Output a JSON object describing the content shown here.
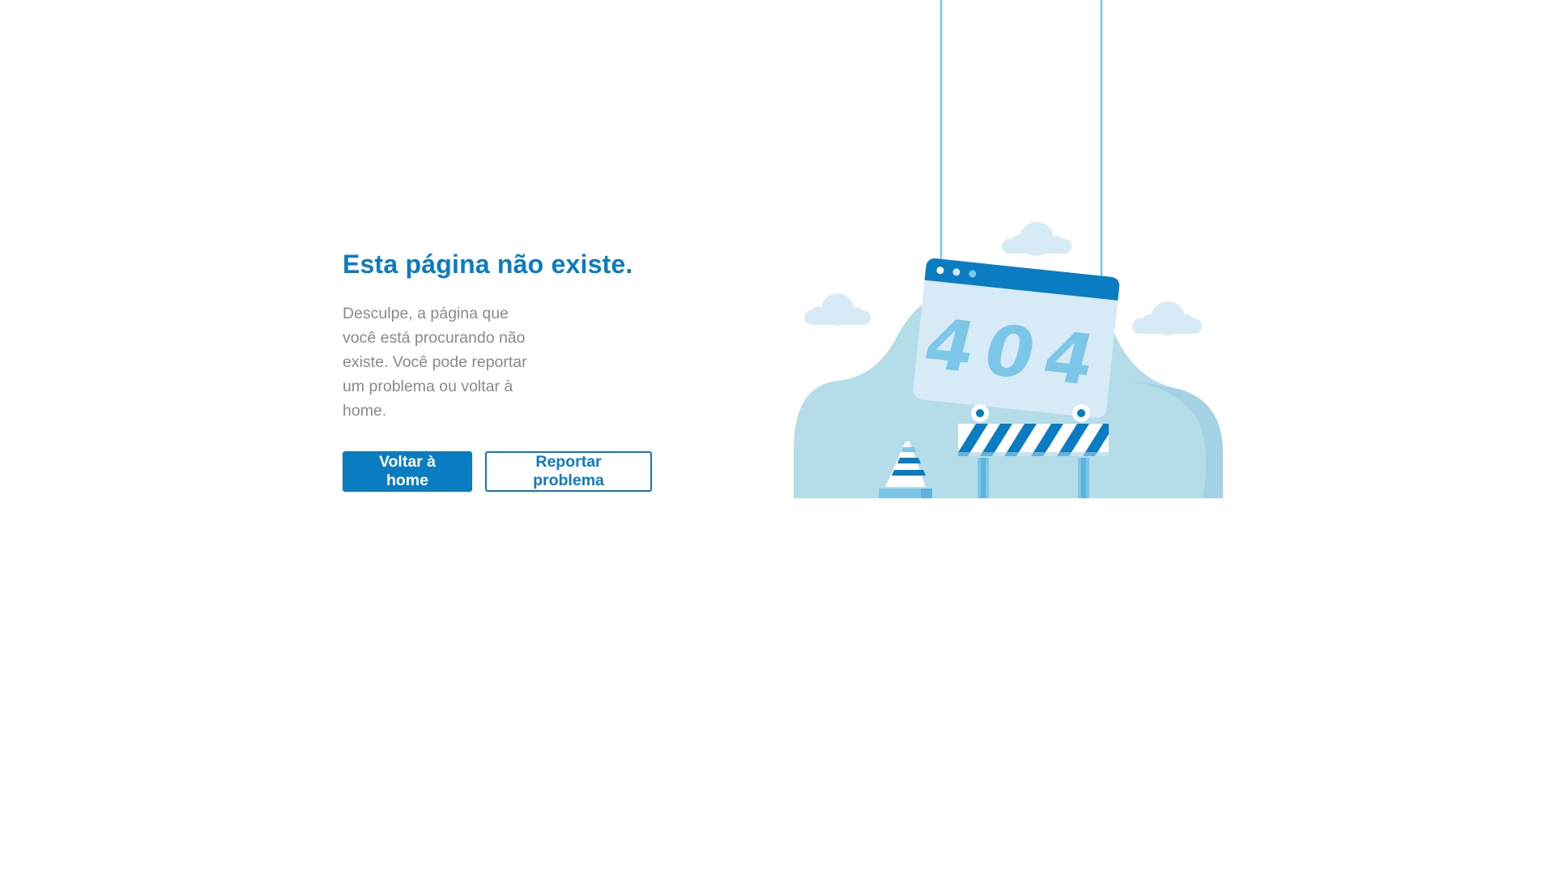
{
  "main": {
    "title": "Esta página não existe.",
    "description": "Desculpe, a página que você está procurando não existe. Você pode reportar um problema ou voltar à home.",
    "buttons": {
      "home_label": "Voltar à home",
      "report_label": "Reportar problema"
    }
  },
  "illustration": {
    "sign_text": "404",
    "icons": [
      "cloud-icon",
      "browser-window-icon",
      "barrier-icon",
      "traffic-cone-icon"
    ]
  },
  "colors": {
    "accent": "#0a7dc2",
    "text_muted": "#8a8a8a",
    "illustration_light": "#d6ebf6",
    "illustration_mid": "#a6d6e6",
    "illustration_dark": "#0a7dc2"
  }
}
